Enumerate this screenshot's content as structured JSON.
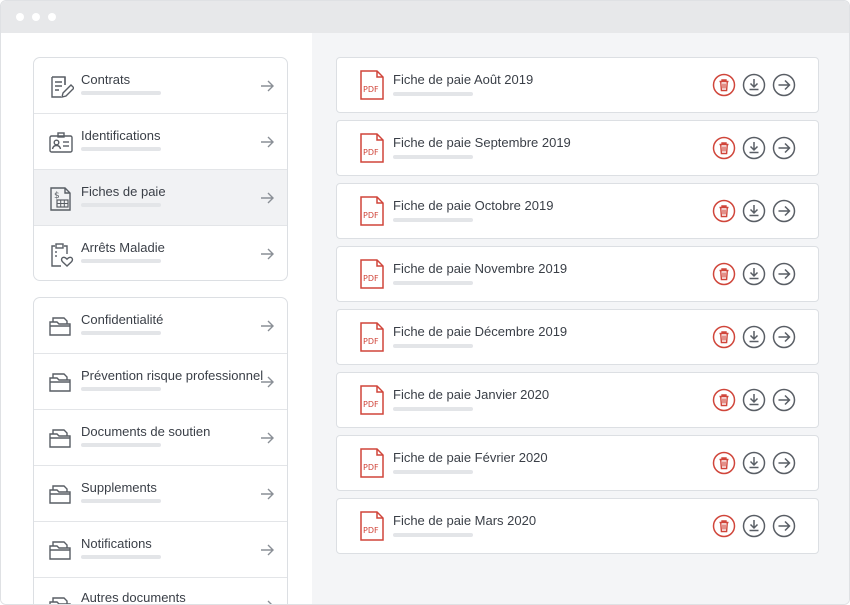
{
  "colors": {
    "accent_red": "#d0453a",
    "icon_gray": "#595e65",
    "active_bg": "#f1f2f4",
    "panel_bg": "#f4f5f7"
  },
  "sidebar": {
    "group1": [
      {
        "label": "Contrats",
        "icon": "contract-pen-icon",
        "active": false
      },
      {
        "label": "Identifications",
        "icon": "id-card-icon",
        "active": false
      },
      {
        "label": "Fiches de paie",
        "icon": "payslip-icon",
        "active": true
      },
      {
        "label": "Arrêts Maladie",
        "icon": "clipboard-heart-icon",
        "active": false
      }
    ],
    "group2": [
      {
        "label": "Confidentialité",
        "icon": "folder-icon",
        "active": false
      },
      {
        "label": "Prévention risque professionnel",
        "icon": "folder-icon",
        "active": false
      },
      {
        "label": "Documents de soutien",
        "icon": "folder-icon",
        "active": false
      },
      {
        "label": "Supplements",
        "icon": "folder-icon",
        "active": false
      },
      {
        "label": "Notifications",
        "icon": "folder-icon",
        "active": false
      },
      {
        "label": "Autres documents",
        "icon": "folder-icon",
        "active": false
      }
    ]
  },
  "documents": [
    {
      "title": "Fiche de paie Août 2019",
      "file_type": "PDF"
    },
    {
      "title": "Fiche de paie Septembre 2019",
      "file_type": "PDF"
    },
    {
      "title": "Fiche de paie Octobre 2019",
      "file_type": "PDF"
    },
    {
      "title": "Fiche de paie Novembre 2019",
      "file_type": "PDF"
    },
    {
      "title": "Fiche de paie Décembre 2019",
      "file_type": "PDF"
    },
    {
      "title": "Fiche de paie Janvier 2020",
      "file_type": "PDF"
    },
    {
      "title": "Fiche de paie Février 2020",
      "file_type": "PDF"
    },
    {
      "title": "Fiche de paie Mars 2020",
      "file_type": "PDF"
    }
  ]
}
